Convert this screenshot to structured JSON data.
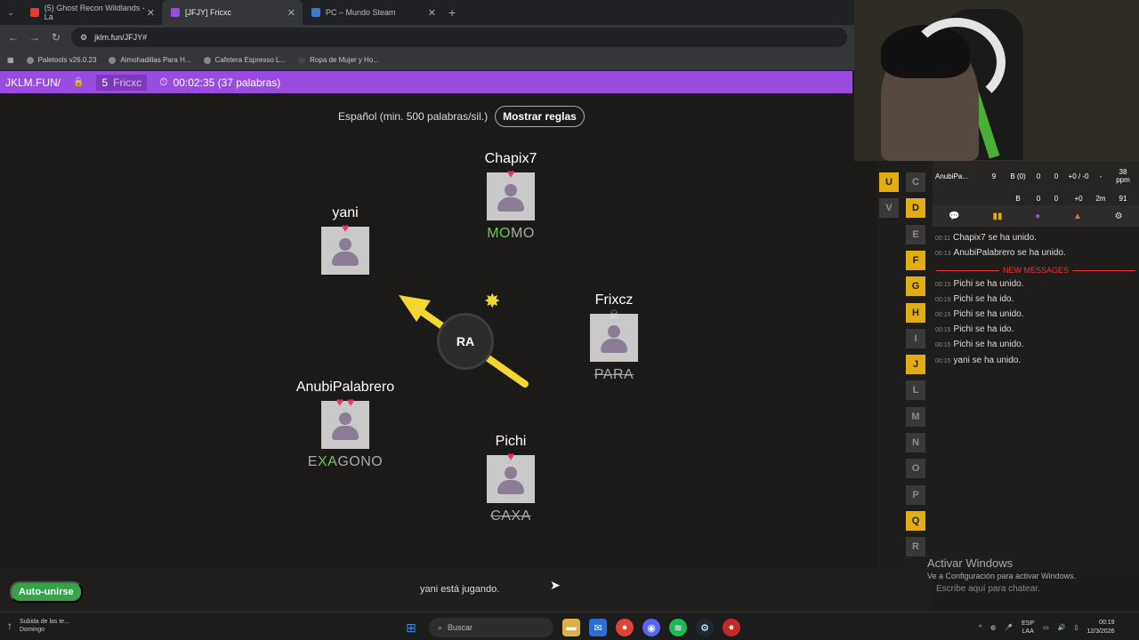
{
  "browser": {
    "tabs": [
      {
        "title": "(5) Ghost Recon Wildlands - La",
        "favicon_color": "#e53935",
        "active": false
      },
      {
        "title": "[JFJY] Fricxc",
        "favicon_color": "#9b4ce0",
        "active": true
      },
      {
        "title": "PC – Mundo Steam",
        "favicon_color": "#3d7ad6",
        "active": false
      }
    ],
    "url": "jklm.fun/JFJY#",
    "bookmarks": [
      {
        "label": "Paletools v26.0.23"
      },
      {
        "label": "Almohadillas Para H..."
      },
      {
        "label": "Cafetera Espresso L..."
      },
      {
        "label": "Ropa de Mujer y Ho..."
      }
    ]
  },
  "gamebar": {
    "room": "JKLM.FUN/",
    "player_count": "5",
    "host": "Fricxc",
    "timer": "00:02:35 (37 palabras)"
  },
  "board": {
    "language": "Español (min. 500 palabras/sil.)",
    "rules_button": "Mostrar reglas",
    "syllable": "RA"
  },
  "players": [
    {
      "name": "Chapix7",
      "hearts": "♥",
      "word_hi": "MO",
      "word_lo": "MO",
      "struck": false
    },
    {
      "name": "yani",
      "hearts": "♥",
      "word_hi": "",
      "word_lo": "",
      "struck": false
    },
    {
      "name": "Frixcz",
      "hearts": "☠",
      "word_hi": "",
      "word_lo": "PARA",
      "struck": true
    },
    {
      "name": "AnubiPalabrero",
      "hearts": "♥ ♥",
      "word_pre": "E",
      "word_hi": "XA",
      "word_lo": "GONO",
      "struck": false
    },
    {
      "name": "Pichi",
      "hearts": "♥",
      "word_hi": "",
      "word_lo": "CAXA",
      "struck": true
    }
  ],
  "bottom": {
    "autojoin": "Auto-unirse",
    "status": "yani está jugando."
  },
  "letters": [
    {
      "l": "U",
      "on": true
    },
    {
      "l": "C",
      "on": false
    },
    {
      "l": "V",
      "on": false
    },
    {
      "l": "D",
      "on": true
    },
    {
      "l": "E",
      "on": false
    },
    {
      "l": "F",
      "on": true
    },
    {
      "l": "G",
      "on": true
    },
    {
      "l": "H",
      "on": true
    },
    {
      "l": "I",
      "on": false
    },
    {
      "l": "J",
      "on": true
    },
    {
      "l": "L",
      "on": false
    },
    {
      "l": "M",
      "on": false
    },
    {
      "l": "N",
      "on": false
    },
    {
      "l": "O",
      "on": false
    },
    {
      "l": "P",
      "on": false
    },
    {
      "l": "Q",
      "on": true
    },
    {
      "l": "R",
      "on": false
    }
  ],
  "stats": {
    "name": "AnubiPa...",
    "words": "9",
    "b": "B (0)",
    "c1": "0",
    "c2": "0",
    "delta": "+0 / -0",
    "dash": "-",
    "ppm_value": "38",
    "ppm_label": "ppm",
    "row2": [
      "B",
      "0",
      "0",
      "+0",
      "2m",
      "91"
    ]
  },
  "chat": {
    "messages": [
      {
        "time": "00:11",
        "text": "Chapix7 se ha unido."
      },
      {
        "time": "00:13",
        "text": "AnubiPalabrero se ha unido."
      },
      {
        "time": "00:15",
        "text": "Pichi se ha unido."
      },
      {
        "time": "00:15",
        "text": "Pichi se ha ido."
      },
      {
        "time": "00:15",
        "text": "Pichi se ha unido."
      },
      {
        "time": "00:15",
        "text": "Pichi se ha ido."
      },
      {
        "time": "00:15",
        "text": "Pichi se ha unido."
      },
      {
        "time": "00:15",
        "text": "yani se ha unido."
      }
    ],
    "new_messages": "NEW MESSAGES",
    "placeholder": "Escribe aquí para chatear.",
    "activate_title": "Activar Windows",
    "activate_sub": "Ve a Configuración para activar Windows."
  },
  "taskbar": {
    "weather_title": "Subida de las te...",
    "weather_sub": "Domingo",
    "search": "Buscar",
    "lang1": "ESP",
    "lang2": "LAA",
    "time": "00:19",
    "date": "12/3/2026"
  },
  "colors": {
    "accent": "#9b4ce0",
    "heart": "#e93474",
    "letter_on": "#e1ad10",
    "correct": "#79c25b"
  }
}
